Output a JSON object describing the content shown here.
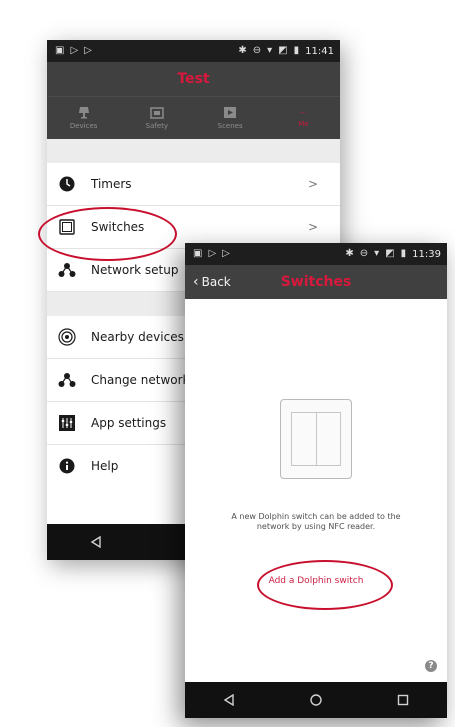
{
  "background_phone": {
    "status": {
      "time": "11:41"
    },
    "appbar": {
      "title": "Test"
    },
    "tabs": [
      {
        "label": "Devices",
        "icon": "lamp-icon"
      },
      {
        "label": "Safety",
        "icon": "safety-icon"
      },
      {
        "label": "Scenes",
        "icon": "scenes-icon"
      },
      {
        "label": "Me",
        "icon": "more-icon"
      }
    ],
    "menu": [
      {
        "label": "Timers",
        "icon": "clock-icon",
        "chevron": ">"
      },
      {
        "label": "Switches",
        "icon": "switch-icon",
        "chevron": ">"
      },
      {
        "label": "Network setup",
        "icon": "network-icon"
      },
      {
        "label": "Nearby devices",
        "icon": "radar-icon"
      },
      {
        "label": "Change network",
        "icon": "network-icon"
      },
      {
        "label": "App settings",
        "icon": "sliders-icon"
      },
      {
        "label": "Help",
        "icon": "info-icon"
      }
    ]
  },
  "foreground_phone": {
    "status": {
      "time": "11:39"
    },
    "appbar": {
      "back_label": "Back",
      "title": "Switches"
    },
    "description": "A new Dolphin switch can be added to the network by using NFC reader.",
    "add_link": "Add a Dolphin switch",
    "help_glyph": "?"
  },
  "navbar_icons": [
    "back-triangle-icon",
    "home-circle-icon",
    "recents-square-icon"
  ],
  "colors": {
    "accent": "#c8102e",
    "appbar": "#404040",
    "statusbar": "#1e1e1e"
  }
}
